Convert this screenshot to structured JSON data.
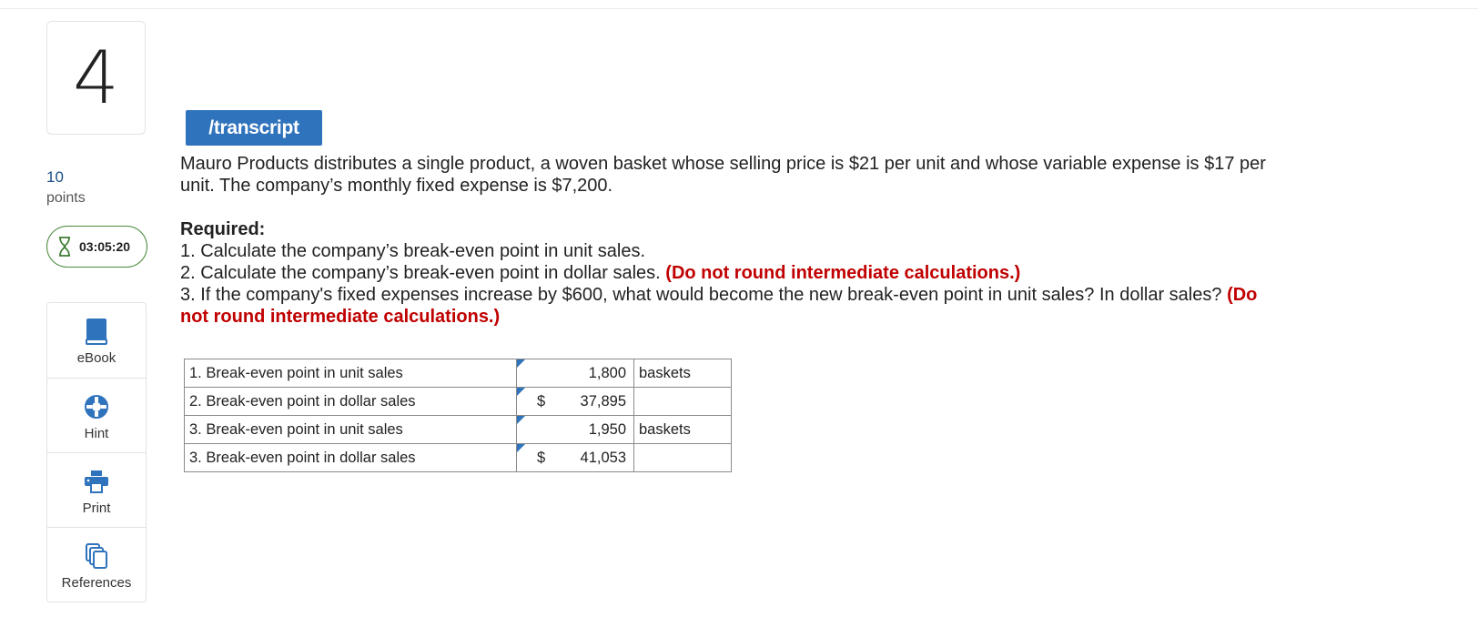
{
  "question": {
    "number": "4",
    "points_value": "10",
    "points_label": "points",
    "timer": "03:05:20"
  },
  "tools": [
    {
      "label": "eBook",
      "icon": "book-icon"
    },
    {
      "label": "Hint",
      "icon": "lifebuoy-icon"
    },
    {
      "label": "Print",
      "icon": "printer-icon"
    },
    {
      "label": "References",
      "icon": "copy-icon"
    }
  ],
  "transcript_label": "/transcript",
  "problem": {
    "line1": "Mauro Products distributes a single product, a woven basket whose selling price is $21 per unit and whose variable expense is $17 per",
    "line2": "unit. The company’s monthly fixed expense is $7,200."
  },
  "required": {
    "title": "Required:",
    "item1": "1. Calculate the company’s break-even point in unit sales.",
    "item2": "2. Calculate the company’s break-even point in dollar sales.",
    "item2_note": "(Do not round intermediate calculations.)",
    "item3": "3. If the company's fixed expenses increase by $600, what would become the new break-even point in unit sales? In dollar sales?",
    "item3_note_a": "(Do",
    "item3_note_b": "not round intermediate calculations.)"
  },
  "answers": [
    {
      "label": "1. Break-even point in unit sales",
      "currency": "",
      "value": "1,800",
      "unit": "baskets"
    },
    {
      "label": "2. Break-even point in dollar sales",
      "currency": "$",
      "value": "37,895",
      "unit": ""
    },
    {
      "label": "3. Break-even point in unit sales",
      "currency": "",
      "value": "1,950",
      "unit": "baskets"
    },
    {
      "label": "3. Break-even point in dollar sales",
      "currency": "$",
      "value": "41,053",
      "unit": ""
    }
  ],
  "colors": {
    "accent": "#2f73bc",
    "timer_border": "#4a8a3c",
    "note_red": "#c00000",
    "points_blue": "#1c4f86"
  }
}
